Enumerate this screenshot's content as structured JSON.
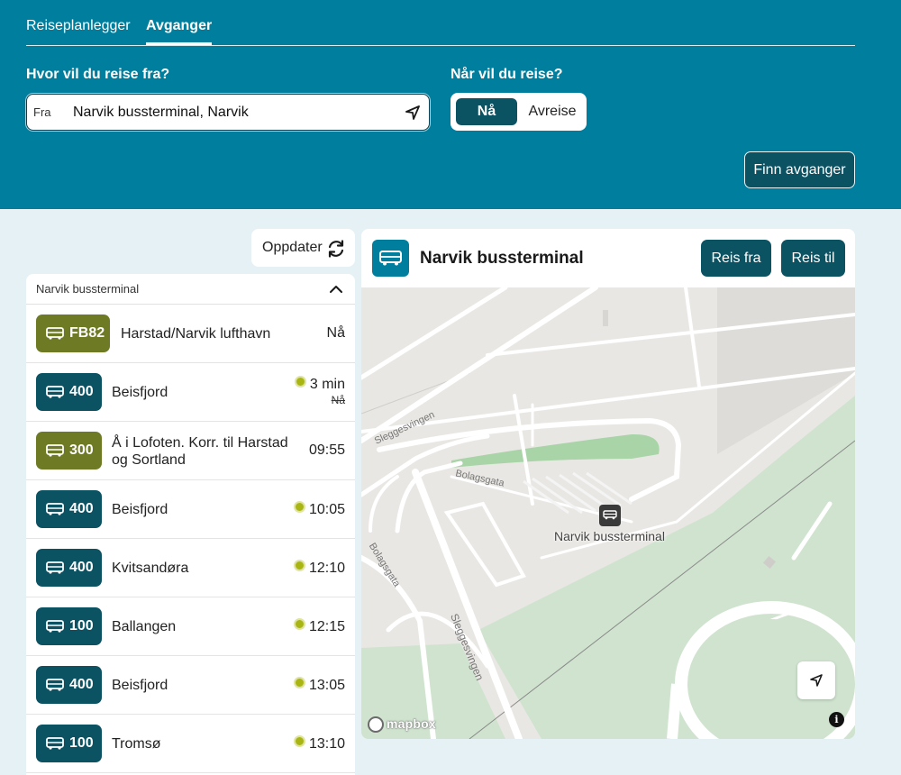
{
  "tabs": {
    "planner": "Reiseplanlegger",
    "departures": "Avganger"
  },
  "search": {
    "from_question": "Hvor vil du reise fra?",
    "when_question": "Når vil du reise?",
    "from_prefix": "Fra",
    "from_value": "Narvik bussterminal, Narvik",
    "time_now": "Nå",
    "time_depart": "Avreise",
    "find_button": "Finn avganger"
  },
  "refresh_label": "Oppdater",
  "stop_group": {
    "name": "Narvik bussterminal"
  },
  "departures": [
    {
      "line": "FB82",
      "color": "#6f7a24",
      "destination": "Harstad/Narvik lufthavn",
      "time": "Nå",
      "realtime": false
    },
    {
      "line": "400",
      "color": "#0b5263",
      "destination": "Beisfjord",
      "time": "3 min",
      "realtime": true,
      "scheduled": "Nå"
    },
    {
      "line": "300",
      "color": "#6f7a24",
      "destination_l1": "Å i Lofoten. Korr. til Harstad",
      "destination_l2": "og Sortland",
      "time": "09:55",
      "realtime": false
    },
    {
      "line": "400",
      "color": "#0b5263",
      "destination": "Beisfjord",
      "time": "10:05",
      "realtime": true
    },
    {
      "line": "400",
      "color": "#0b5263",
      "destination": "Kvitsandøra",
      "time": "12:10",
      "realtime": true
    },
    {
      "line": "100",
      "color": "#0b5263",
      "destination": "Ballangen",
      "time": "12:15",
      "realtime": true
    },
    {
      "line": "400",
      "color": "#0b5263",
      "destination": "Beisfjord",
      "time": "13:05",
      "realtime": true
    },
    {
      "line": "100",
      "color": "#0b5263",
      "destination": "Tromsø",
      "time": "13:10",
      "realtime": true
    }
  ],
  "map": {
    "stop_title": "Narvik bussterminal",
    "travel_from": "Reis fra",
    "travel_to": "Reis til",
    "terminal_label": "Narvik bussterminal",
    "street_labels": {
      "sleggesvingen_1": "Sleggesvingen",
      "bolagsgata_1": "Bolagsgata",
      "bolagsgata_2": "Bolagsgata",
      "sleggesvingen_2": "Sleggesvingen"
    },
    "attribution": "mapbox",
    "info": "i"
  },
  "colors": {
    "header": "#007e9d",
    "dark_teal": "#0b5263",
    "olive": "#6f7a24",
    "realtime": "#a9b512",
    "background": "#e6f1f5"
  }
}
